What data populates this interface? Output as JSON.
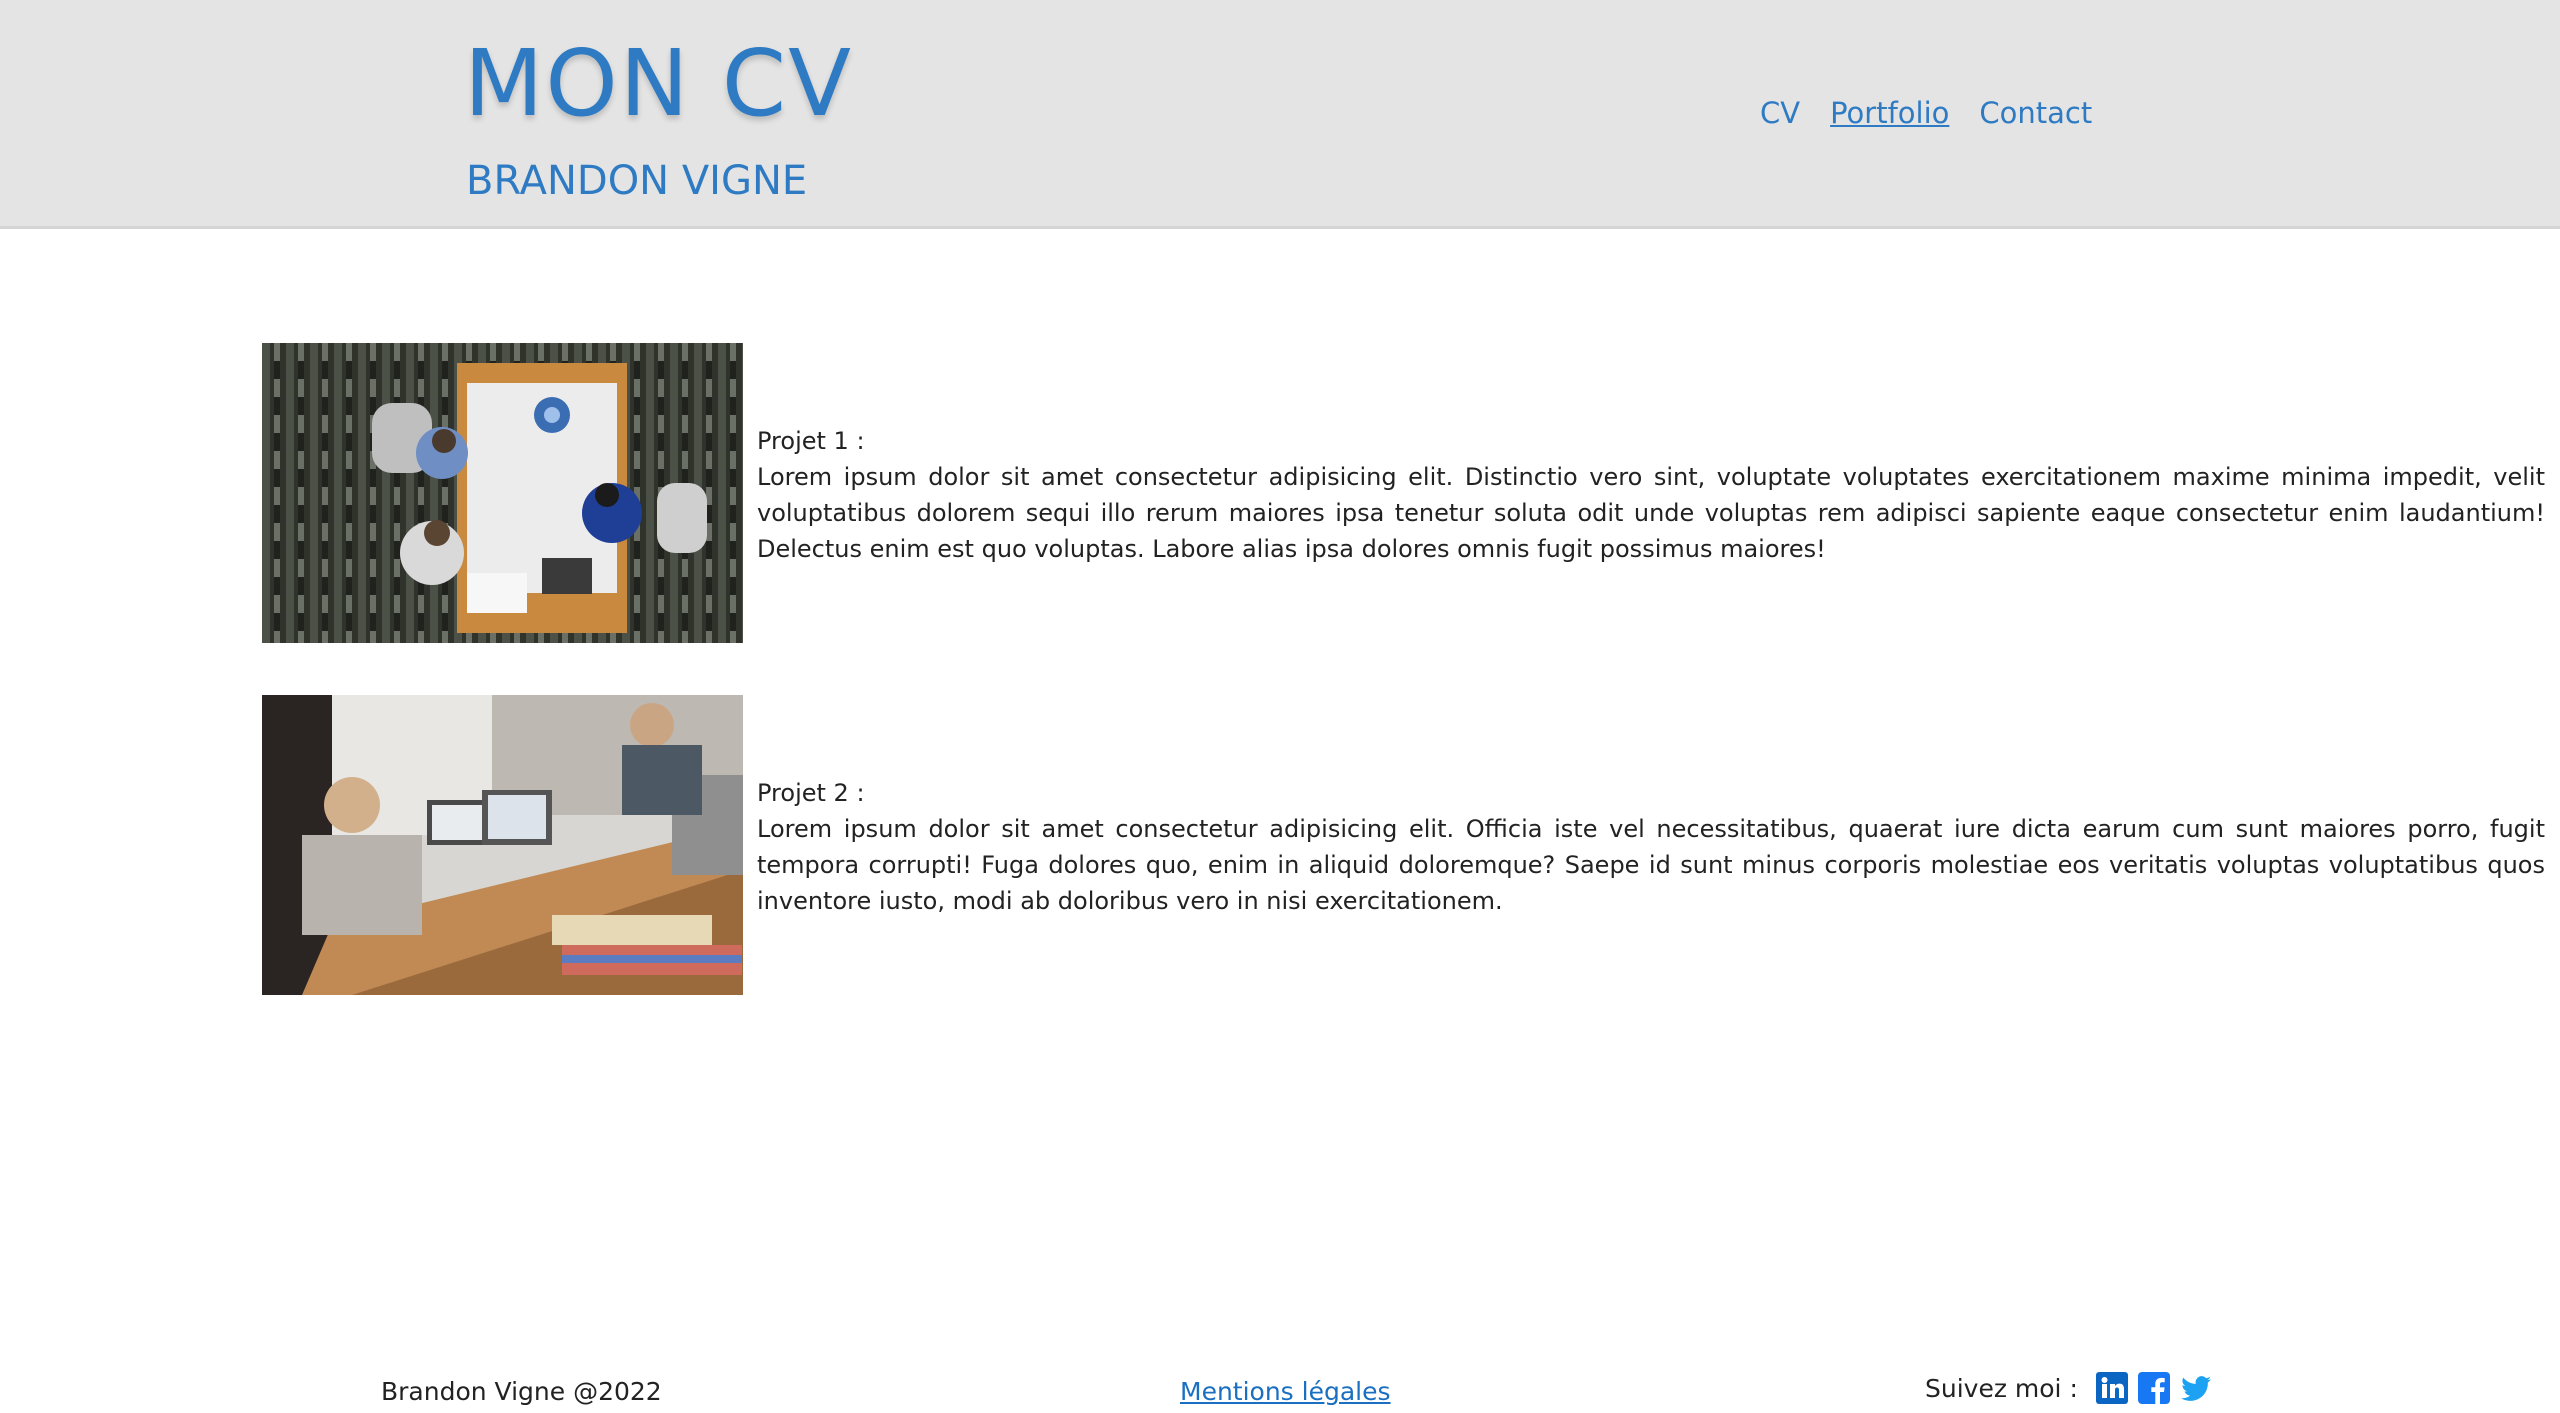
{
  "header": {
    "title": "MON CV",
    "subtitle": "BRANDON VIGNE",
    "nav": [
      {
        "label": "CV"
      },
      {
        "label": "Portfolio"
      },
      {
        "label": "Contact"
      }
    ]
  },
  "projects": [
    {
      "title": "Projet 1 :",
      "body": "Lorem ipsum dolor sit amet consectetur adipisicing elit. Distinctio vero sint, voluptate voluptates exercitationem maxime minima impedit, velit voluptatibus dolorem sequi illo rerum maiores ipsa tenetur soluta odit unde voluptas rem adipisci sapiente eaque consectetur enim laudantium! Delectus enim est quo voluptas. Labore alias ipsa dolores omnis fugit possimus maiores!",
      "image": "office-meeting-top-view-photo"
    },
    {
      "title": "Projet 2 :",
      "body": "Lorem ipsum dolor sit amet consectetur adipisicing elit. Officia iste vel necessitatibus, quaerat iure dicta earum cum sunt maiores porro, fugit tempora corrupti! Fuga dolores quo, enim in aliquid doloremque? Saepe id sunt minus corporis molestiae eos veritatis voluptas voluptatibus quos inventore iusto, modi ab doloribus vero in nisi exercitationem.",
      "image": "team-laptops-meeting-photo"
    }
  ],
  "footer": {
    "copyright": "Brandon Vigne @2022",
    "legal_link": "Mentions légales",
    "follow_label": "Suivez moi :",
    "social": [
      {
        "icon": "linkedin-icon",
        "color": "#0a66c2"
      },
      {
        "icon": "facebook-icon",
        "color": "#1877f2"
      },
      {
        "icon": "twitter-icon",
        "color": "#1da1f2"
      }
    ]
  },
  "colors": {
    "accent": "#2e7bc4",
    "header_bg": "#e4e4e4",
    "link": "#1a6fc0"
  }
}
